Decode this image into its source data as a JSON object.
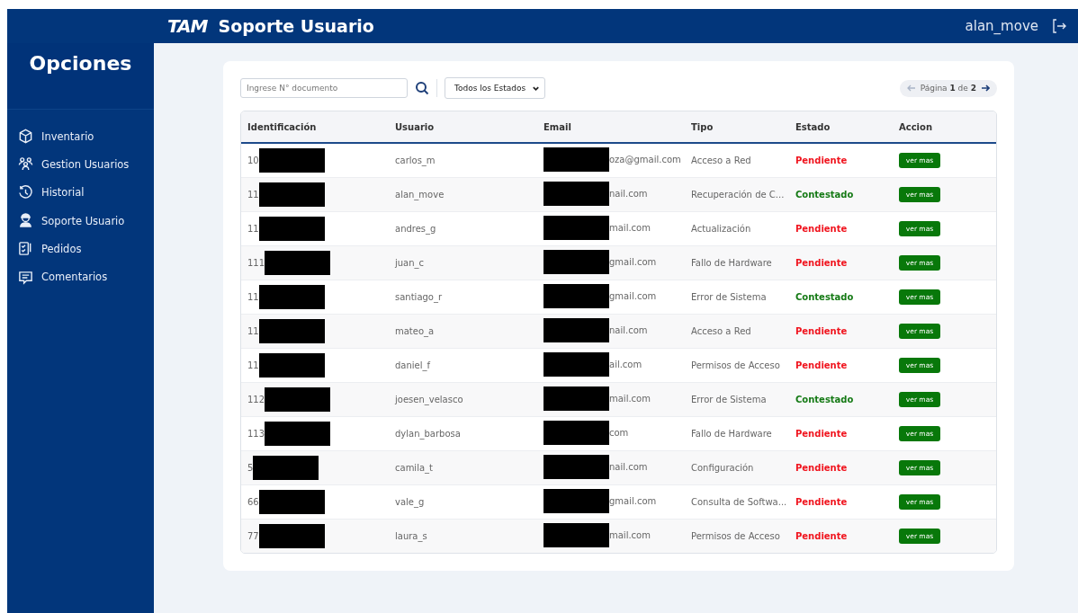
{
  "header": {
    "logo": "TAM",
    "title": "Soporte Usuario",
    "user": "alan_move"
  },
  "sidebar": {
    "title": "Opciones",
    "items": [
      {
        "label": "Inventario",
        "kind": "box",
        "selected": false
      },
      {
        "label": "Gestion Usuarios",
        "kind": "users",
        "selected": false
      },
      {
        "label": "Historial",
        "kind": "history",
        "selected": false
      },
      {
        "label": "Soporte Usuario",
        "kind": "support",
        "selected": false
      },
      {
        "label": "Pedidos",
        "kind": "orders",
        "selected": false
      },
      {
        "label": "Comentarios",
        "kind": "comments",
        "selected": false
      }
    ]
  },
  "search": {
    "placeholder": "Ingrese N° documento"
  },
  "filter": {
    "value": "Todos los Estados"
  },
  "pagination": {
    "text": "Página **1** de **2**"
  },
  "table": {
    "columns": [
      "Identificación",
      "Usuario",
      "Email",
      "Tipo",
      "Estado",
      "Accion"
    ],
    "rows": [
      {
        "id": "10",
        "user": "carlos_m",
        "email": "oza@gmail.com",
        "type": "Acceso a Red",
        "status": "Pendiente",
        "kind": "pending",
        "action": "ver mas"
      },
      {
        "id": "11",
        "user": "alan_move",
        "email": "nail.com",
        "type": "Recuperación de C...",
        "status": "Contestado",
        "kind": "answered",
        "action": "ver mas"
      },
      {
        "id": "11",
        "user": "andres_g",
        "email": "mail.com",
        "type": "Actualización",
        "status": "Pendiente",
        "kind": "pending",
        "action": "ver mas"
      },
      {
        "id": "111",
        "user": "juan_c",
        "email": "gmail.com",
        "type": "Fallo de Hardware",
        "status": "Pendiente",
        "kind": "pending",
        "action": "ver mas"
      },
      {
        "id": "11",
        "user": "santiago_r",
        "email": "gmail.com",
        "type": "Error de Sistema",
        "status": "Contestado",
        "kind": "answered",
        "action": "ver mas"
      },
      {
        "id": "11",
        "user": "mateo_a",
        "email": "nail.com",
        "type": "Acceso a Red",
        "status": "Pendiente",
        "kind": "pending",
        "action": "ver mas"
      },
      {
        "id": "11",
        "user": "daniel_f",
        "email": "ail.com",
        "type": "Permisos de Acceso",
        "status": "Pendiente",
        "kind": "pending",
        "action": "ver mas"
      },
      {
        "id": "112",
        "user": "joesen_velasco",
        "email": "mail.com",
        "type": "Error de Sistema",
        "status": "Contestado",
        "kind": "answered",
        "action": "ver mas"
      },
      {
        "id": "113",
        "user": "dylan_barbosa",
        "email": "com",
        "type": "Fallo de Hardware",
        "status": "Pendiente",
        "kind": "pending",
        "action": "ver mas"
      },
      {
        "id": "5",
        "user": "camila_t",
        "email": "nail.com",
        "type": "Configuración",
        "status": "Pendiente",
        "kind": "pending",
        "action": "ver mas"
      },
      {
        "id": "66",
        "user": "vale_g",
        "email": "gmail.com",
        "type": "Consulta de Softwa...",
        "status": "Pendiente",
        "kind": "pending",
        "action": "ver mas"
      },
      {
        "id": "77",
        "user": "laura_s",
        "email": "mail.com",
        "type": "Permisos de Acceso",
        "status": "Pendiente",
        "kind": "pending",
        "action": "ver mas"
      }
    ]
  }
}
